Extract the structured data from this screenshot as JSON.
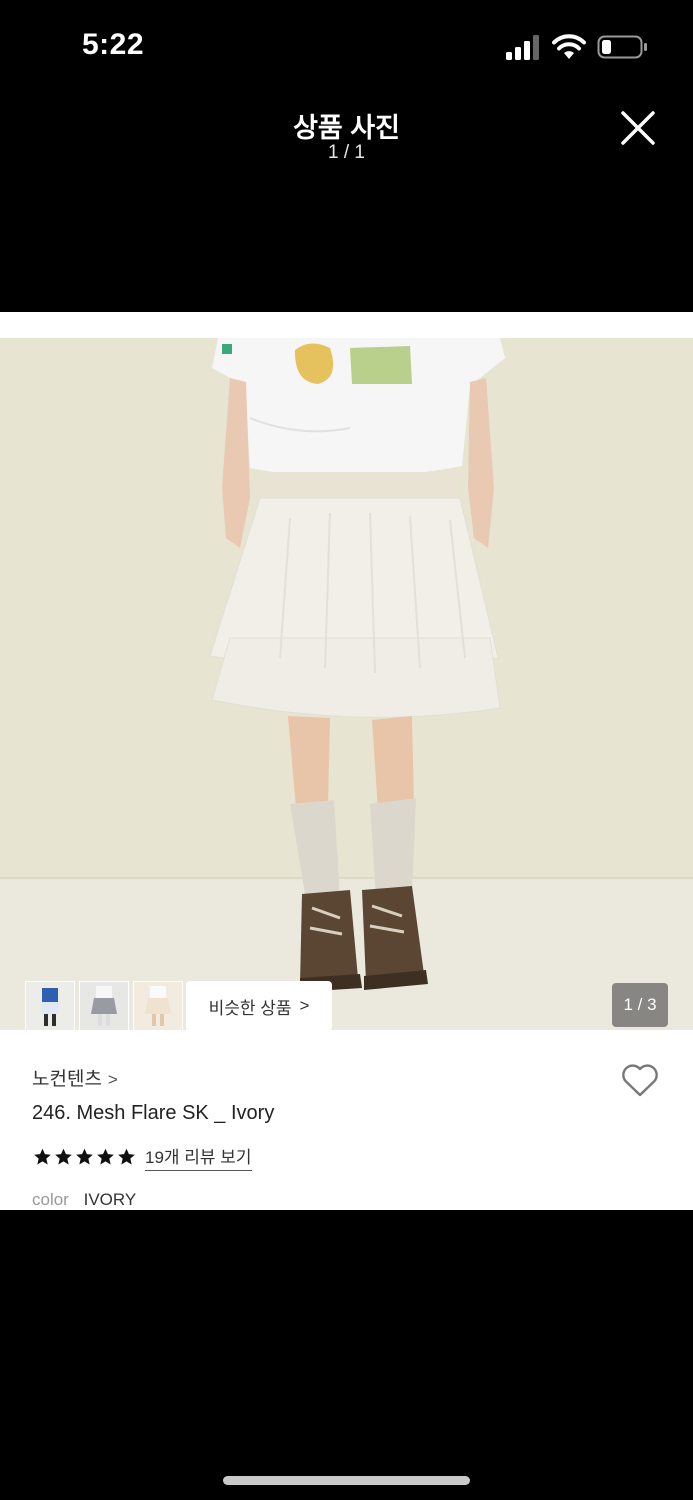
{
  "status_bar": {
    "time": "5:22",
    "icons": [
      "cellular-signal-icon",
      "wifi-icon",
      "battery-icon"
    ]
  },
  "viewer": {
    "title": "상품 사진",
    "counter": "1 / 1",
    "close_icon": "close-icon"
  },
  "gallery": {
    "thumbnails": [
      "thumbnail-1",
      "thumbnail-2",
      "thumbnail-3"
    ],
    "similar_button_label": "비슷한 상품",
    "photo_counter": "1 / 3"
  },
  "product": {
    "brand": "노컨텐츠",
    "name": "246. Mesh Flare SK _ Ivory",
    "rating_stars": 5,
    "review_link": "19개 리뷰 보기",
    "color_label": "color",
    "color_value": "IVORY",
    "wishlist_icon": "heart-icon"
  },
  "colors": {
    "background": "#000000",
    "photo_wall": "#e7e4d3",
    "text_primary": "#222222",
    "text_muted": "#999999"
  }
}
